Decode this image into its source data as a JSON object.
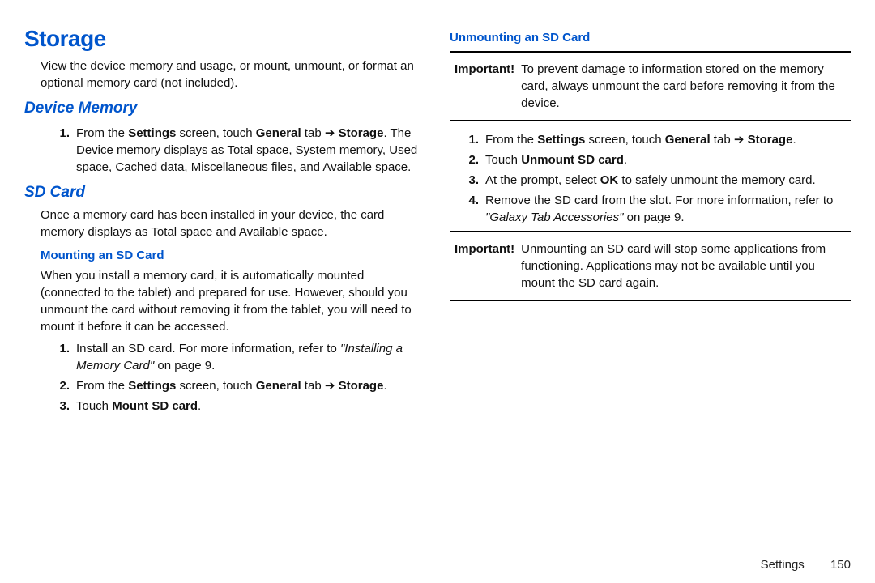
{
  "headings": {
    "page_title": "Storage",
    "device_memory": "Device Memory",
    "sd_card": "SD Card",
    "mounting": "Mounting an SD Card",
    "unmounting": "Unmounting an SD Card"
  },
  "paragraphs": {
    "lead": "View the device memory and usage, or mount, unmount, or format an optional memory card (not included).",
    "sd_desc": "Once a memory card has been installed in your device, the card memory displays as Total space and Available space.",
    "mount_desc": "When you install a memory card, it is automatically mounted (connected to the tablet) and prepared for use. However, should you unmount the card without removing it from the tablet, you will need to mount it before it can be accessed."
  },
  "device_memory_step": {
    "prefix": "From the ",
    "bold1": "Settings",
    "mid1": " screen, touch ",
    "bold2": "General",
    "mid2": " tab ➔ ",
    "bold3": "Storage",
    "rest": ". The Device memory displays as Total space, System memory, Used space, Cached data, Miscellaneous files, and Available space."
  },
  "mount_steps": {
    "s1": {
      "text": "Install an SD card. For more information, refer to ",
      "ref": "\"Installing a Memory Card\"",
      "tail": " on page 9."
    },
    "s2": {
      "prefix": "From the ",
      "bold1": "Settings",
      "mid1": " screen, touch ",
      "bold2": "General",
      "mid2": " tab ➔ ",
      "bold3": "Storage",
      "tail": "."
    },
    "s3": {
      "prefix": "Touch ",
      "bold1": "Mount SD card",
      "tail": "."
    }
  },
  "important_top": {
    "label": "Important!",
    "text": "To prevent damage to information stored on the memory card, always unmount the card before removing it from the device."
  },
  "unmount_steps": {
    "s1": {
      "prefix": "From the ",
      "bold1": "Settings",
      "mid1": " screen, touch ",
      "bold2": "General",
      "mid2": " tab ➔ ",
      "bold3": "Storage",
      "tail": "."
    },
    "s2": {
      "prefix": "Touch ",
      "bold1": "Unmount SD card",
      "tail": "."
    },
    "s3": {
      "prefix": "At the prompt, select ",
      "bold1": "OK",
      "tail": " to safely unmount the memory card."
    },
    "s4": {
      "text": "Remove the SD card from the slot. For more information, refer to ",
      "ref": "\"Galaxy Tab Accessories\"",
      "tail": " on page 9."
    }
  },
  "important_bottom": {
    "label": "Important!",
    "text": "Unmounting an SD card will stop some applications from functioning. Applications may not be available until you mount the SD card again."
  },
  "footer": {
    "section": "Settings",
    "page": "150"
  },
  "numbers": {
    "n1": "1.",
    "n2": "2.",
    "n3": "3.",
    "n4": "4."
  }
}
